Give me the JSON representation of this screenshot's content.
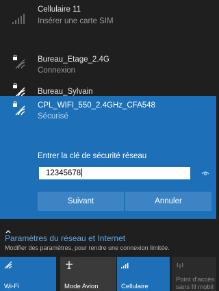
{
  "cellular": {
    "name": "Cellulaire 11",
    "status": "Insérer une carte SIM"
  },
  "networks": [
    {
      "name": "Bureau_Etage_2.4G",
      "status": "Connexion"
    },
    {
      "name": "Bureau_Sylvain",
      "status": ""
    }
  ],
  "selected": {
    "name": "CPL_WIFI_550_2.4GHz_CFA548",
    "security": "Sécurisé",
    "key_label": "Entrer la clé de sécurité réseau",
    "key_value": "12345678",
    "next_label": "Suivant",
    "cancel_label": "Annuler"
  },
  "settings": {
    "title": "Paramètres du réseau et Internet",
    "subtitle": "Modifier des paramètres, pour rendre une connexion limitée."
  },
  "tiles": [
    {
      "label": "Wi-Fi",
      "icon": "wifi-icon",
      "active": true
    },
    {
      "label": "Mode Avion",
      "icon": "airplane-icon",
      "active": false
    },
    {
      "label": "Cellulaire",
      "icon": "cellular-icon",
      "active": true
    },
    {
      "label": "Point d'accès sans fil mobile",
      "line1": "Point d'accès",
      "line2": "sans fil mobil",
      "icon": "hotspot-icon",
      "active": false
    }
  ],
  "colors": {
    "accent": "#1d70b8",
    "link": "#5fa9e8",
    "background": "#1f1f1f"
  }
}
